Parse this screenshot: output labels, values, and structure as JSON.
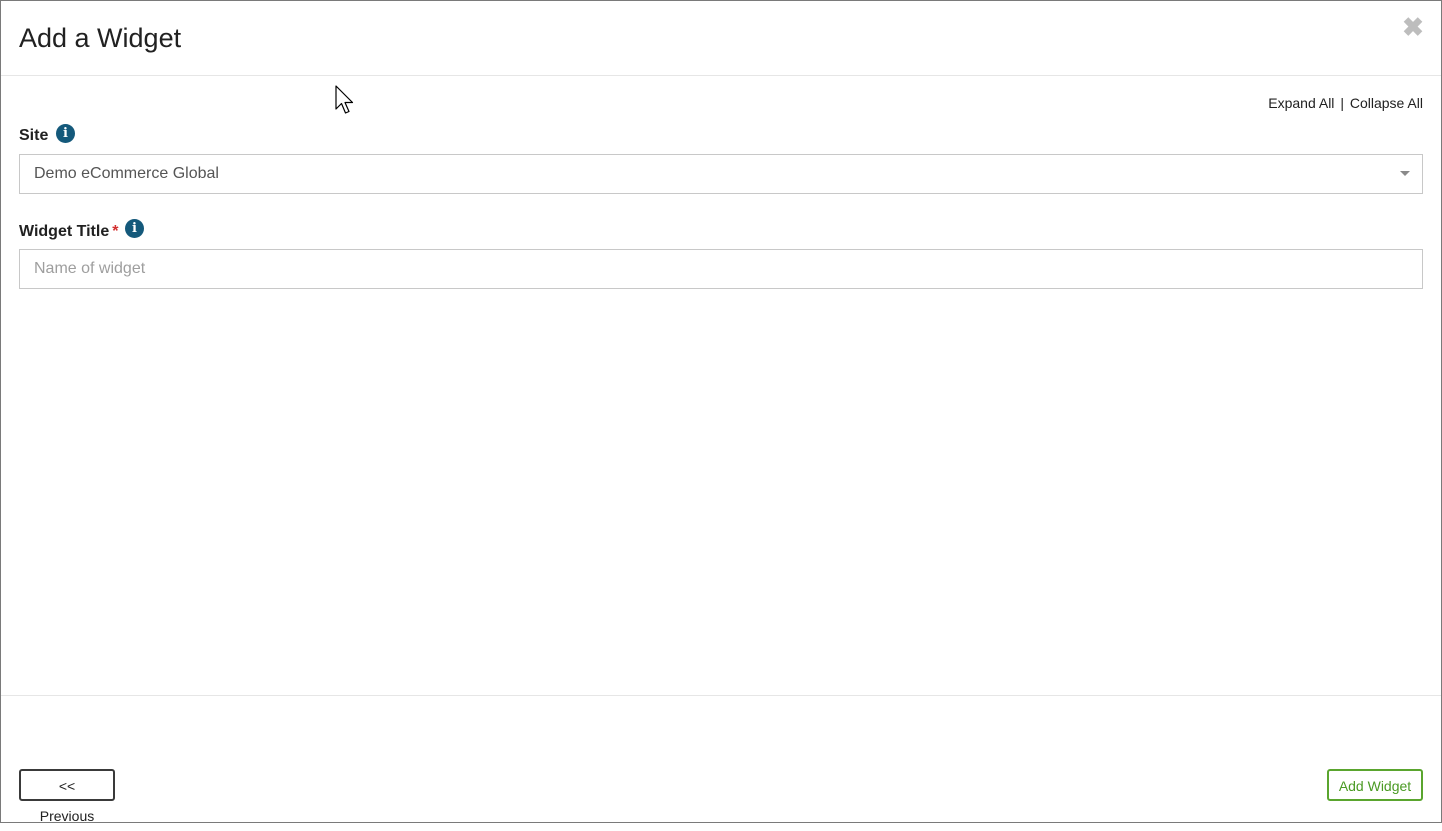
{
  "modal": {
    "title": "Add a Widget",
    "close_symbol": "✖"
  },
  "controls": {
    "expand_all": "Expand All",
    "separator": "|",
    "collapse_all": "Collapse All"
  },
  "site_field": {
    "label": "Site",
    "selected_value": "Demo eCommerce Global",
    "info_icon": "info-icon"
  },
  "title_field": {
    "label": "Widget Title",
    "required_marker": "*",
    "value": "",
    "placeholder": "Name of widget",
    "info_icon": "info-icon"
  },
  "footer": {
    "previous_label": "<< Previous",
    "add_label": "Add Widget"
  },
  "colors": {
    "info_icon": "#14597b",
    "required": "#d32f2f",
    "add_button": "#5aa52e"
  }
}
